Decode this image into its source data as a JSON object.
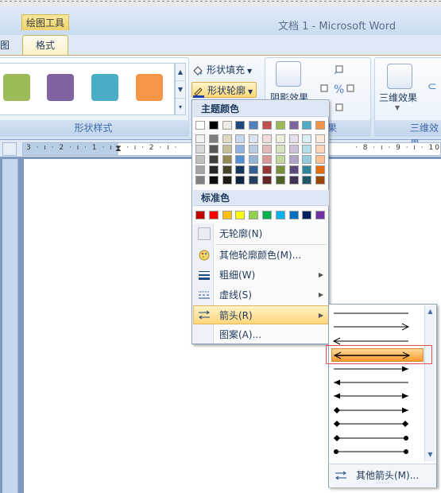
{
  "titlebar": {
    "context_group": "绘图工具",
    "doc_title": "文档 1 - Microsoft Word"
  },
  "tabs": {
    "left_partial": "图",
    "format": "格式"
  },
  "ribbon": {
    "shape_styles_label": "形状样式",
    "shape_swatches": [
      "#9bbb59",
      "#8064a2",
      "#4bacc6",
      "#f79646"
    ],
    "shape_fill": "形状填充",
    "shape_outline": "形状轮廓",
    "shadow_effects": "阴影效果",
    "shadow_group_partial": "果",
    "threed_effects": "三维效果",
    "threed_group_partial": "三维效果"
  },
  "ruler": {
    "text": "3 · ı · 2 · ı · 1 · ı · ",
    "text2": "· ı · 2 · ı ·",
    "text3": "· 8 · ı · 9 · ı · 10 · ı"
  },
  "outline_menu": {
    "theme_colors_header": "主题颜色",
    "theme_top_row": [
      "#ffffff",
      "#000000",
      "#eeece1",
      "#1f497d",
      "#4f81bd",
      "#c0504d",
      "#9bbb59",
      "#8064a2",
      "#4bacc6",
      "#f79646"
    ],
    "theme_shades": [
      [
        "#f2f2f2",
        "#7f7f7f",
        "#ddd9c3",
        "#c6d9f0",
        "#dbe5f1",
        "#f2dcdb",
        "#ebf1dd",
        "#e5e0ec",
        "#dbeef3",
        "#fdeada"
      ],
      [
        "#d8d8d8",
        "#595959",
        "#c4bd97",
        "#8db3e2",
        "#b8cce4",
        "#e5b9b7",
        "#d7e3bc",
        "#ccc1d9",
        "#b7dde8",
        "#fbd5b5"
      ],
      [
        "#bfbfbf",
        "#3f3f3f",
        "#938953",
        "#548dd4",
        "#95b3d7",
        "#d99694",
        "#c3d69b",
        "#b2a2c7",
        "#92cddc",
        "#fac08f"
      ],
      [
        "#a5a5a5",
        "#262626",
        "#494429",
        "#17365d",
        "#366092",
        "#953734",
        "#76923c",
        "#5f497a",
        "#31859b",
        "#e36c09"
      ],
      [
        "#7f7f7f",
        "#0c0c0c",
        "#1d1b10",
        "#0f243e",
        "#244061",
        "#632423",
        "#4f6128",
        "#3f3151",
        "#205867",
        "#974806"
      ]
    ],
    "standard_colors_header": "标准色",
    "standard_colors": [
      "#c00000",
      "#ff0000",
      "#ffc000",
      "#ffff00",
      "#92d050",
      "#00b050",
      "#00b0f0",
      "#0070c0",
      "#002060",
      "#7030a0"
    ],
    "items": {
      "no_outline": "无轮廓(N)",
      "more_colors": "其他轮廓颜色(M)...",
      "weight": "粗细(W)",
      "dashes": "虚线(S)",
      "arrows": "箭头(R)",
      "pattern": "图案(A)..."
    }
  },
  "arrow_submenu": {
    "options": [
      "plain-line",
      "end-arrow-open",
      "start-arrow-open",
      "double-arrow-open",
      "end-arrow-solid",
      "start-arrow-solid",
      "double-arrow-solid",
      "diamond-start-arrow-end",
      "diamond-both-ends",
      "diamond-start-circle-end",
      "circle-both-ends"
    ],
    "selected_option": "double-arrow-open",
    "more_arrows": "其他箭头(M)..."
  }
}
